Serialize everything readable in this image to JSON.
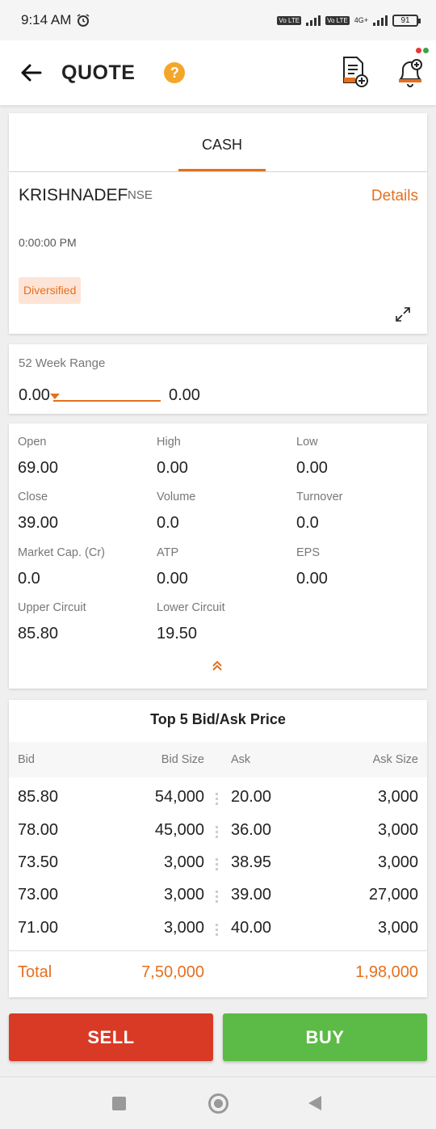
{
  "status_bar": {
    "time": "9:14 AM",
    "network1": "Vo LTE",
    "network2": "4G+",
    "battery": "91"
  },
  "app_bar": {
    "title": "QUOTE",
    "help": "?"
  },
  "tabs": [
    {
      "label": "CASH",
      "active": true
    }
  ],
  "instrument": {
    "symbol": "KRISHNADEF",
    "exchange": "NSE",
    "details_label": "Details",
    "time": "0:00:00 PM",
    "sector": "Diversified"
  },
  "week_range": {
    "label": "52 Week Range",
    "low": "0.00",
    "high": "0.00",
    "fill": 0.0
  },
  "stats": [
    {
      "label": "Open",
      "value": "69.00"
    },
    {
      "label": "High",
      "value": "0.00"
    },
    {
      "label": "Low",
      "value": "0.00"
    },
    {
      "label": "Close",
      "value": "39.00"
    },
    {
      "label": "Volume",
      "value": "0.0"
    },
    {
      "label": "Turnover",
      "value": "0.0"
    },
    {
      "label": "Market Cap. (Cr)",
      "value": "0.0"
    },
    {
      "label": "ATP",
      "value": "0.00"
    },
    {
      "label": "EPS",
      "value": "0.00"
    },
    {
      "label": "Upper Circuit",
      "value": "85.80"
    },
    {
      "label": "Lower Circuit",
      "value": "19.50"
    }
  ],
  "bid_ask": {
    "title": "Top 5 Bid/Ask Price",
    "headers": {
      "bid": "Bid",
      "bid_size": "Bid Size",
      "ask": "Ask",
      "ask_size": "Ask Size"
    },
    "rows": [
      {
        "bid": "85.80",
        "bid_size": "54,000",
        "ask": "20.00",
        "ask_size": "3,000"
      },
      {
        "bid": "78.00",
        "bid_size": "45,000",
        "ask": "36.00",
        "ask_size": "3,000"
      },
      {
        "bid": "73.50",
        "bid_size": "3,000",
        "ask": "38.95",
        "ask_size": "3,000"
      },
      {
        "bid": "73.00",
        "bid_size": "3,000",
        "ask": "39.00",
        "ask_size": "27,000"
      },
      {
        "bid": "71.00",
        "bid_size": "3,000",
        "ask": "40.00",
        "ask_size": "3,000"
      }
    ],
    "total": {
      "label": "Total",
      "bid_total": "7,50,000",
      "ask_total": "1,98,000"
    }
  },
  "actions": {
    "sell": "SELL",
    "buy": "BUY"
  },
  "colors": {
    "accent": "#e4701e",
    "sell": "#d93a26",
    "buy": "#5bbb46",
    "help": "#f4a62a"
  }
}
